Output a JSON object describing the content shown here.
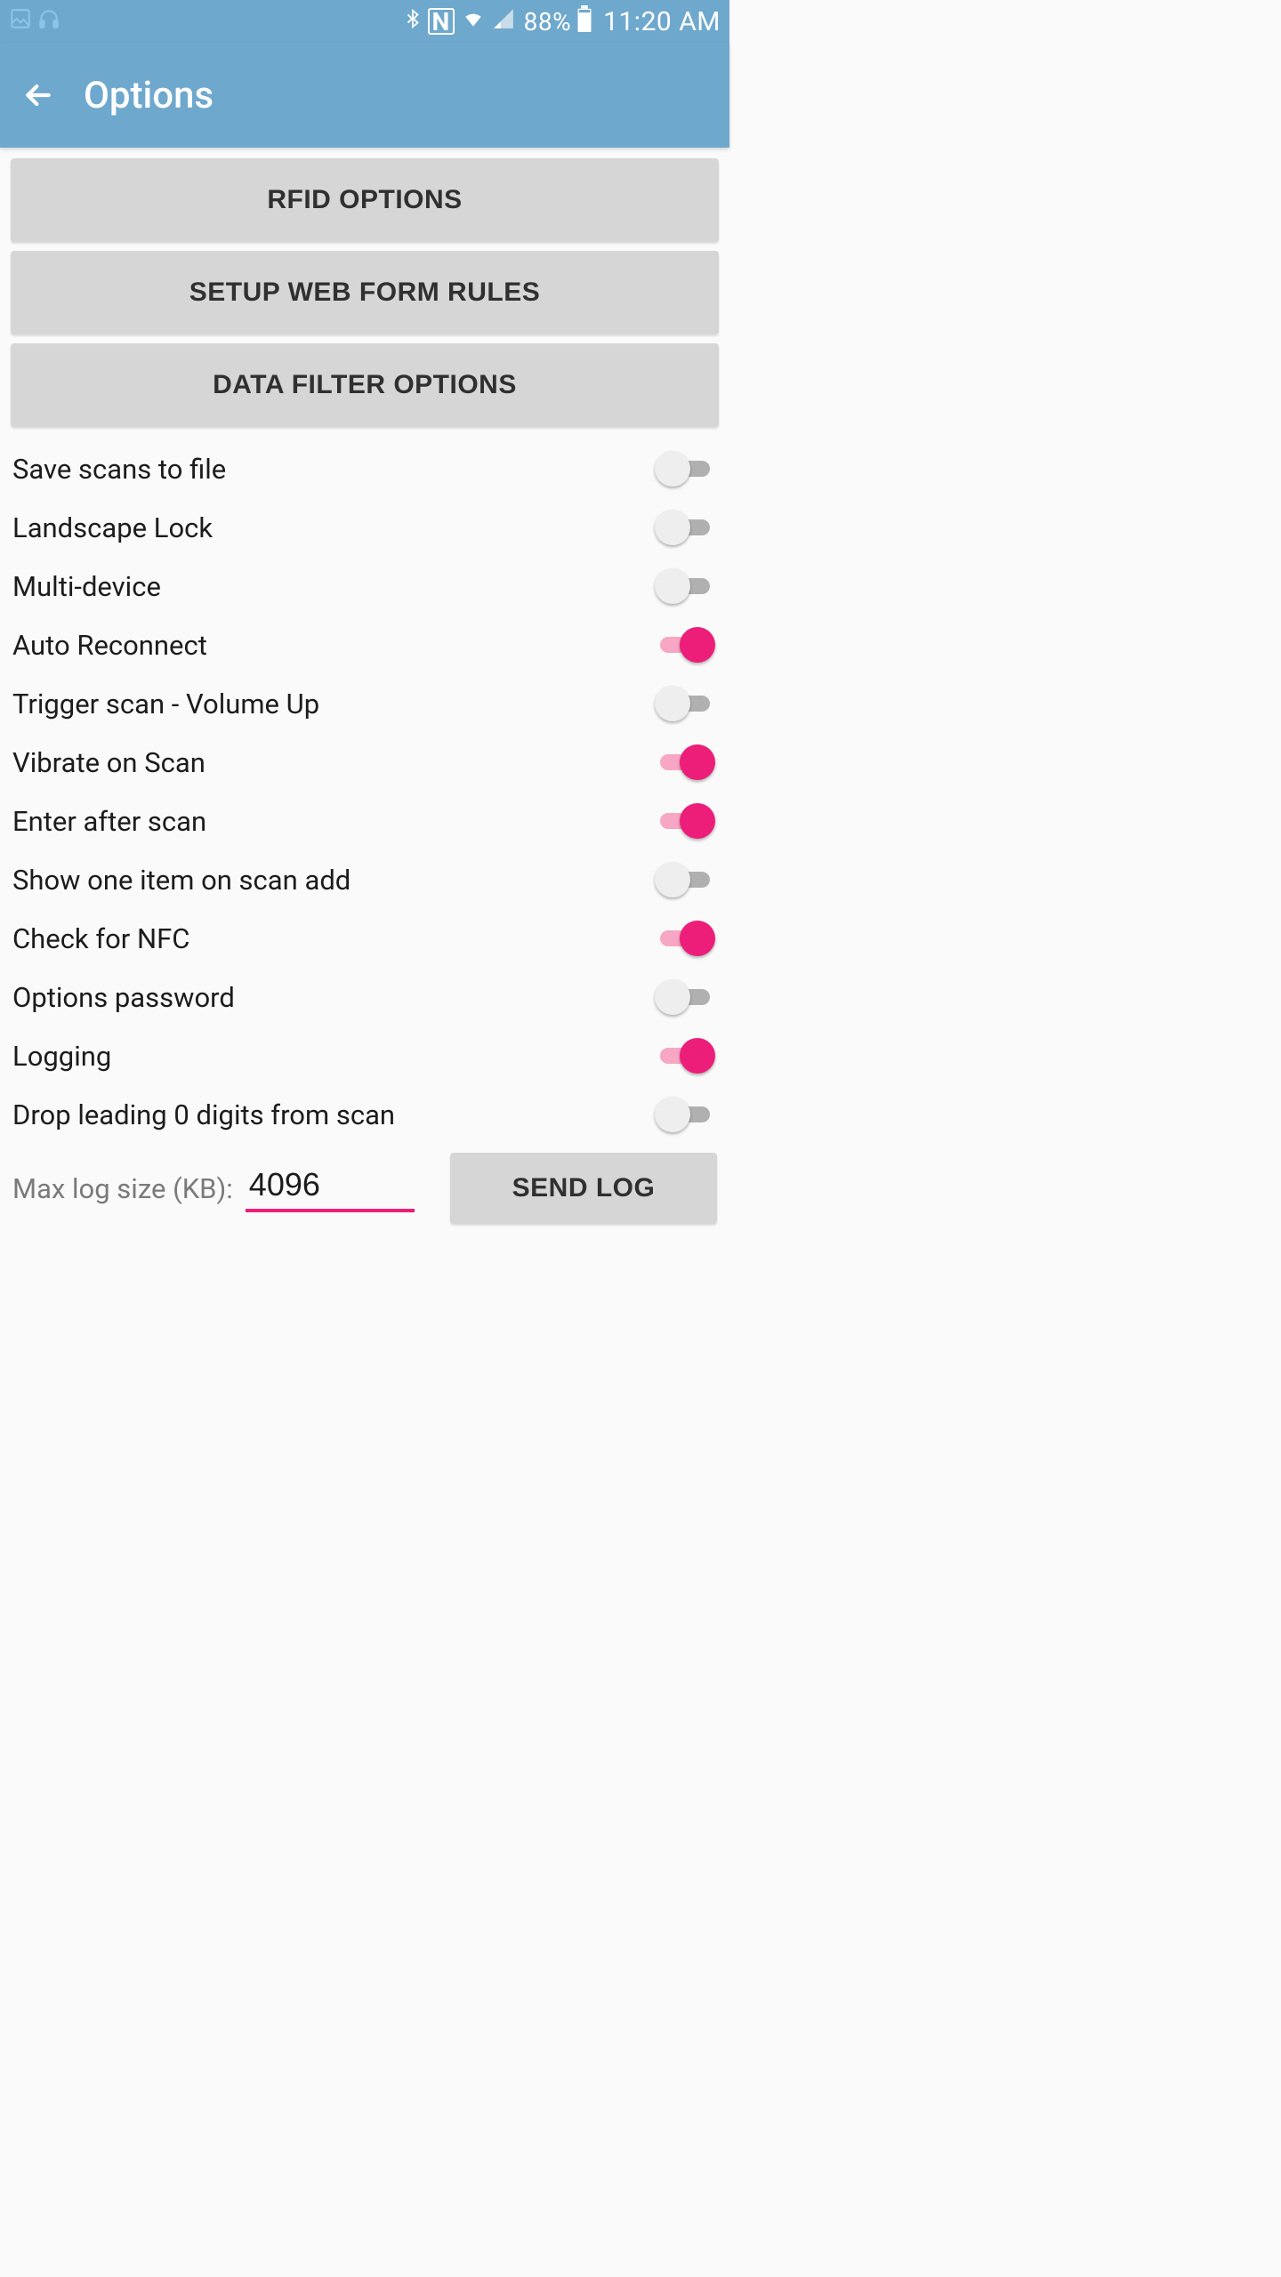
{
  "status": {
    "battery_pct": "88%",
    "time": "11:20 AM",
    "icons": {
      "gallery": "gallery-icon",
      "headphones": "headphones-icon",
      "bluetooth": "bluetooth-icon",
      "nfc": "nfc-icon",
      "wifi": "wifi-icon",
      "cell": "cell-signal-icon",
      "battery": "battery-icon"
    }
  },
  "header": {
    "title": "Options"
  },
  "buttons": {
    "rfid": "RFID OPTIONS",
    "web_form": "SETUP WEB FORM RULES",
    "data_filter": "DATA FILTER OPTIONS",
    "send_log": "SEND LOG"
  },
  "options": [
    {
      "label": "Save scans to file",
      "on": false
    },
    {
      "label": "Landscape Lock",
      "on": false
    },
    {
      "label": "Multi-device",
      "on": false
    },
    {
      "label": "Auto Reconnect",
      "on": true
    },
    {
      "label": "Trigger scan - Volume Up",
      "on": false
    },
    {
      "label": "Vibrate on Scan",
      "on": true
    },
    {
      "label": "Enter after scan",
      "on": true
    },
    {
      "label": "Show one item on scan add",
      "on": false
    },
    {
      "label": "Check for NFC",
      "on": true
    },
    {
      "label": "Options password",
      "on": false
    },
    {
      "label": "Logging",
      "on": true
    },
    {
      "label": "Drop leading 0 digits from scan",
      "on": false
    }
  ],
  "maxlog": {
    "label": "Max log size (KB):",
    "value": "4096"
  }
}
